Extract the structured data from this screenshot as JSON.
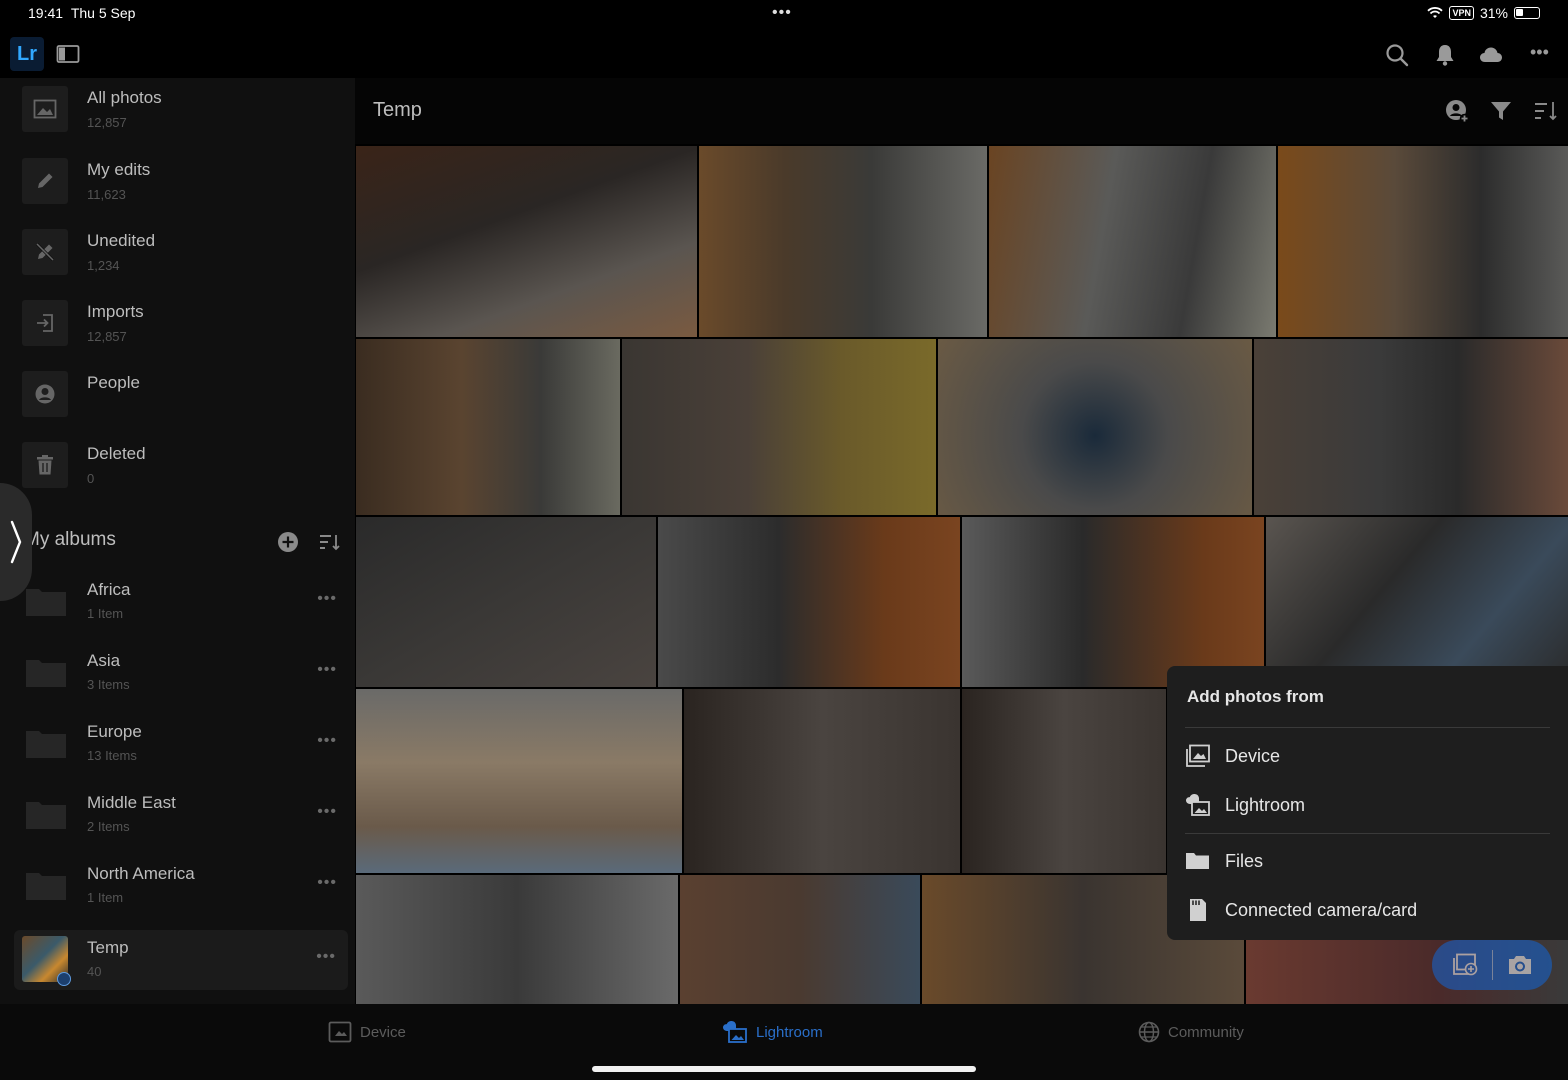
{
  "status_bar": {
    "time": "19:41",
    "date": "Thu 5 Sep",
    "dots": "•••",
    "vpn": "VPN",
    "battery": "31%"
  },
  "toolbar": {
    "logo": "Lr",
    "icons": [
      "panel-toggle-icon",
      "search-icon",
      "bell-icon",
      "cloud-icon",
      "more-icon"
    ],
    "more": "•••"
  },
  "sidebar": {
    "items": [
      {
        "label": "All photos",
        "count": "12,857",
        "icon": "photo-icon"
      },
      {
        "label": "My edits",
        "count": "11,623",
        "icon": "pencil-icon"
      },
      {
        "label": "Unedited",
        "count": "1,234",
        "icon": "pencil-off-icon"
      },
      {
        "label": "Imports",
        "count": "12,857",
        "icon": "import-icon"
      },
      {
        "label": "People",
        "count": "",
        "icon": "person-icon"
      },
      {
        "label": "Deleted",
        "count": "0",
        "icon": "trash-icon"
      }
    ],
    "albums_title": "My albums",
    "albums": [
      {
        "label": "Africa",
        "count": "1 Item"
      },
      {
        "label": "Asia",
        "count": "3 Items"
      },
      {
        "label": "Europe",
        "count": "13 Items"
      },
      {
        "label": "Middle East",
        "count": "2 Items"
      },
      {
        "label": "North America",
        "count": "1 Item"
      },
      {
        "label": "Temp",
        "count": "40"
      }
    ],
    "more": "•••"
  },
  "main": {
    "title": "Temp",
    "header_icons": [
      "add-person-icon",
      "filter-icon",
      "sort-icon"
    ]
  },
  "popup": {
    "title": "Add photos from",
    "items": [
      {
        "label": "Device",
        "icon": "device-photos-icon"
      },
      {
        "label": "Lightroom",
        "icon": "cloud-photos-icon"
      },
      {
        "label": "Files",
        "icon": "folder-icon"
      },
      {
        "label": "Connected camera/card",
        "icon": "sd-card-icon"
      }
    ]
  },
  "bottom_nav": {
    "items": [
      {
        "label": "Device",
        "icon": "device-icon"
      },
      {
        "label": "Lightroom",
        "icon": "lightroom-cloud-icon",
        "active": true
      },
      {
        "label": "Community",
        "icon": "globe-icon"
      }
    ]
  },
  "colors": {
    "accent": "#1266d6",
    "active_nav": "#2a6fc9",
    "logo_blue": "#31a8ff"
  }
}
